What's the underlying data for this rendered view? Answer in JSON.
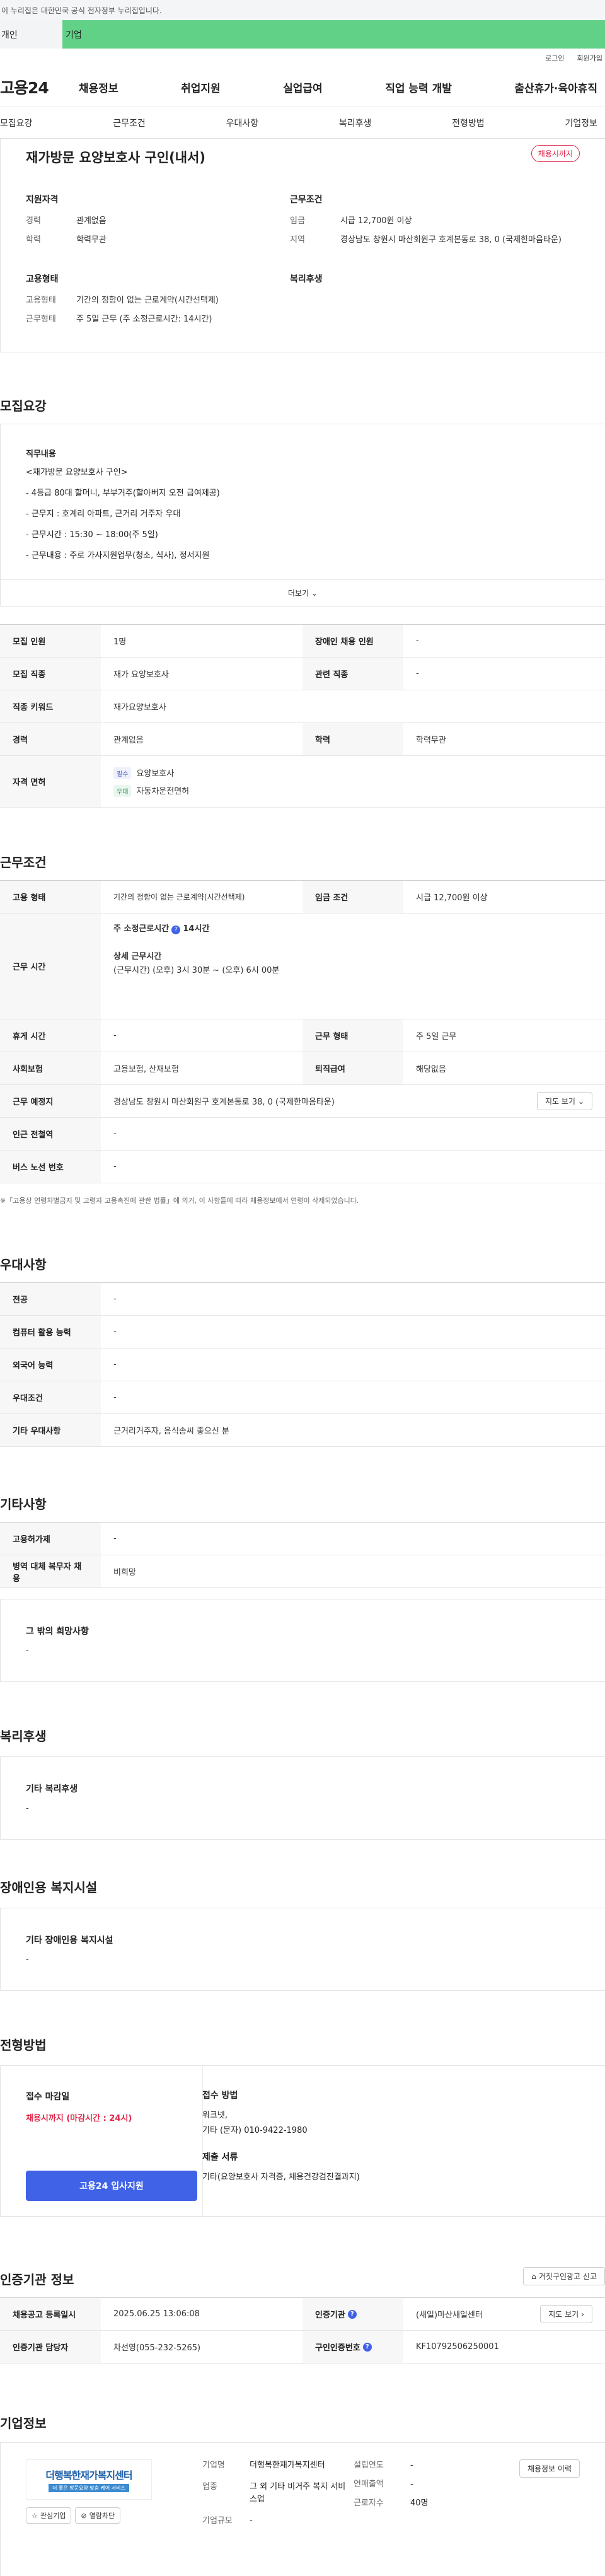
{
  "gov_banner": "이 누리집은 대한민국 공식 전자정부 누리집입니다.",
  "user_tabs": {
    "personal": "개인",
    "company": "기업"
  },
  "util": {
    "login": "로그인",
    "join": "회원가입"
  },
  "logo": "고용24",
  "gnb": [
    "채용정보",
    "취업지원",
    "실업급여",
    "직업 능력 개발",
    "출산휴가·육아휴직"
  ],
  "tabs": [
    "모집요강",
    "근무조건",
    "우대사항",
    "복리후생",
    "전형방법",
    "기업정보"
  ],
  "summary": {
    "title": "재가방문 요양보호사 구인(내서)",
    "badge": "채용시까지",
    "qual": {
      "title": "지원자격",
      "rows": [
        [
          "경력",
          "관계없음"
        ],
        [
          "학력",
          "학력무관"
        ]
      ]
    },
    "cond": {
      "title": "근무조건",
      "rows": [
        [
          "임금",
          "시급 12,700원 이상"
        ],
        [
          "지역",
          "경상남도 창원시 마산회원구 호계본동로 38, 0 (국제한마음타운)"
        ]
      ]
    },
    "emp": {
      "title": "고용형태",
      "rows": [
        [
          "고용형태",
          "기간의 정함이 없는 근로계약(시간선택제)"
        ],
        [
          "근무형태",
          "주 5일 근무 (주 소정근로시간: 14시간)"
        ]
      ]
    },
    "welfare": {
      "title": "복리후생"
    }
  },
  "recruit": {
    "title": "모집요강",
    "duty_title": "직무내용",
    "duty_lines": [
      "<재가방문 요양보호사 구인>",
      "- 4등급 80대 할머니, 부부거주(할아버지 오전 급여제공)",
      "- 근무지 : 호계리 아파트, 근거리 거주자 우대",
      "- 근무시간 :  15:30 ~ 18:00(주 5일)",
      "- 근무내용 : 주로 가사지원업무(청소, 식사), 정서지원"
    ],
    "more": "더보기",
    "rows": {
      "r1": [
        "모집 인원",
        "1명",
        "장애인 채용 인원",
        "-"
      ],
      "r2": [
        "모집 직종",
        "재가 요양보호사",
        "관련 직종",
        "-"
      ],
      "r3": [
        "직종 키워드",
        "재가요양보호사"
      ],
      "r4": [
        "경력",
        "관계없음",
        "학력",
        "학력무관"
      ],
      "r5_h": "자격 면허",
      "lic": [
        {
          "tag": "필수",
          "name": "요양보호사"
        },
        {
          "tag": "우대",
          "name": "자동차운전면허"
        }
      ]
    }
  },
  "work": {
    "title": "근무조건",
    "r1": [
      "고용 형태",
      "기간의 정함이 없는 근로계약(시간선택제)",
      "임금 조건",
      "시급 12,700원 이상"
    ],
    "r2_h": "근무 시간",
    "r2_a": "주 소정근로시간",
    "r2_b": "14시간",
    "r2_c": "상세 근무시간",
    "r2_d": "(근무시간) (오후) 3시 30분 ~ (오후) 6시 00분",
    "r3": [
      "휴게 시간",
      "-",
      "근무 형태",
      "주 5일 근무"
    ],
    "r4": [
      "사회보험",
      "고용보험, 산재보험",
      "퇴직급여",
      "해당없음"
    ],
    "r5": [
      "근무 예정지",
      "경상남도 창원시 마산회원구 호계본동로 38, 0 (국제한마음타운)",
      "지도 보기"
    ],
    "r6": [
      "인근 전철역",
      "-"
    ],
    "r7": [
      "버스 노선 번호",
      "-"
    ],
    "note": "※「고용상 연령차별금지 및 고령자 고용촉진에 관한 법률」에 의거, 이 사항들에 따라 채용정보에서 연령이 삭제되었습니다."
  },
  "pref": {
    "title": "우대사항",
    "rows": [
      [
        "전공",
        "-"
      ],
      [
        "컴퓨터 활용 능력",
        "-"
      ],
      [
        "외국어 능력",
        "-"
      ],
      [
        "우대조건",
        "-"
      ],
      [
        "기타 우대사항",
        "근거리거주자, 음식솜씨 좋으신 분"
      ]
    ]
  },
  "etc": {
    "title": "기타사항",
    "rows": [
      [
        "고용허가제",
        "-"
      ],
      [
        "병역 대체 복무자 채용",
        "비희망"
      ]
    ],
    "card_t": "그 밖의 희망사항",
    "card_v": "-"
  },
  "welfare": {
    "title": "복리후생",
    "card_t": "기타 복리후생",
    "card_v": "-"
  },
  "disab": {
    "title": "장애인용 복지시설",
    "card_t": "기타 장애인용 복지시설",
    "card_v": "-"
  },
  "select": {
    "title": "전형방법",
    "deadline_t": "접수 마감일",
    "deadline_v": "채용시까지 (마감시간 : 24시)",
    "method_t": "접수 방법",
    "method_v1": "워크넷,",
    "method_v2": "기타 (문자) 010-9422-1980",
    "docs_t": "제출 서류",
    "docs_v": "기타(요양보호사 자격증, 채용건강검진결과지)",
    "apply": "고용24 입사지원"
  },
  "cert": {
    "title": "인증기관 정보",
    "report": "거짓구인광고 신고",
    "r1": [
      "채용공고 등록일시",
      "2025.06.25 13:06:08",
      "인증기관",
      "(새일)마산새일센터",
      "지도 보기"
    ],
    "r2": [
      "인증기관 담당자",
      "차선영(055-232-5265)",
      "구인인증번호",
      "KF10792506250001"
    ]
  },
  "company": {
    "title": "기업정보",
    "logo_text": "더행복한재가복지센터",
    "logo_sub": "더 좋은 방문요양 맞춤 케어 서비스",
    "fav": "관심기업",
    "block": "열람차단",
    "history": "채용정보 이력",
    "rows": [
      [
        "기업명",
        "더행복한재가복지센터"
      ],
      [
        "업종",
        "그 외 기타 비거주 복지 서비스업"
      ],
      [
        "기업규모",
        "-"
      ]
    ],
    "rows2": [
      [
        "설립연도",
        "-"
      ],
      [
        "연매출액",
        "-"
      ],
      [
        "근로자수",
        "40명"
      ]
    ]
  }
}
